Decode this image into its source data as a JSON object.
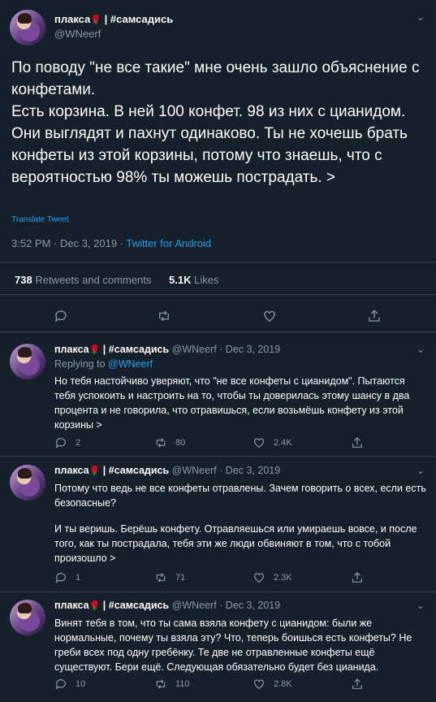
{
  "main_tweet": {
    "display_name": "плакса",
    "community": "| #самсадись",
    "handle": "@WNeerf",
    "text_lines": [
      "По поводу \"не все такие\" мне очень зашло объяснение с конфетами.",
      "Есть корзина. В ней 100 конфет. 98 из них с цианидом. Они выглядят и пахнут одинаково. Ты не хочешь брать конфеты из этой корзины, потому что знаешь, что с вероятностью 98% ты можешь пострадать. >"
    ],
    "translate_label": "Translate Tweet",
    "time": "3:52 PM · Dec 3, 2019 · ",
    "source": "Twitter for Android",
    "retweets_count": "738",
    "retweets_label": "Retweets and comments",
    "likes_count": "5.1K",
    "likes_label": "Likes",
    "icons": [
      "reply-icon",
      "retweet-icon",
      "like-icon",
      "share-icon",
      "chevron-down-icon"
    ]
  },
  "replies": [
    {
      "display_name": "плакса",
      "community": "| #самсадись",
      "handle_date": "@WNeerf · Dec 3, 2019",
      "replying_prefix": "Replying to",
      "replying_to": "@WNeerf",
      "paragraphs": [
        "Но тебя настойчиво уверяют, что \"не все конфеты с цианидом\". Пытаются тебя успокоить и настроить на то, чтобы ты доверилась этому шансу в два процента и не говорила, что отравишься, если возьмёшь конфету из этой корзины >"
      ],
      "reply_count": "2",
      "retweet_count": "80",
      "like_count": "2.4K"
    },
    {
      "display_name": "плакса",
      "community": "| #самсадись",
      "handle_date": "@WNeerf · Dec 3, 2019",
      "paragraphs": [
        "Потому что ведь не все конфеты отравлены. Зачем говорить о всех, если есть безопасные?",
        "И ты веришь. Берёшь конфету. Отравляешься или умираешь вовсе, и после того, как ты пострадала, тебя эти же люди обвиняют в том, что с тобой произошло >"
      ],
      "reply_count": "1",
      "retweet_count": "71",
      "like_count": "2.3K"
    },
    {
      "display_name": "плакса",
      "community": "| #самсадись",
      "handle_date": "@WNeerf · Dec 3, 2019",
      "paragraphs": [
        "Винят тебя в том, что ты сама взяла конфету с цианидом: были же нормальные, почему ты взяла эту? Что, теперь боишься есть конфеты? Не греби всех под одну гребёнку. Те две не отравленные конфеты ещё существуют. Бери ещё. Следующая обязательно будет без цианида."
      ],
      "reply_count": "10",
      "retweet_count": "110",
      "like_count": "2.8K"
    }
  ],
  "colors": {
    "background": "#15202b",
    "accent": "#1da1f2",
    "muted": "#8899a6",
    "divider": "#38444d",
    "rose": "#e0245e"
  }
}
